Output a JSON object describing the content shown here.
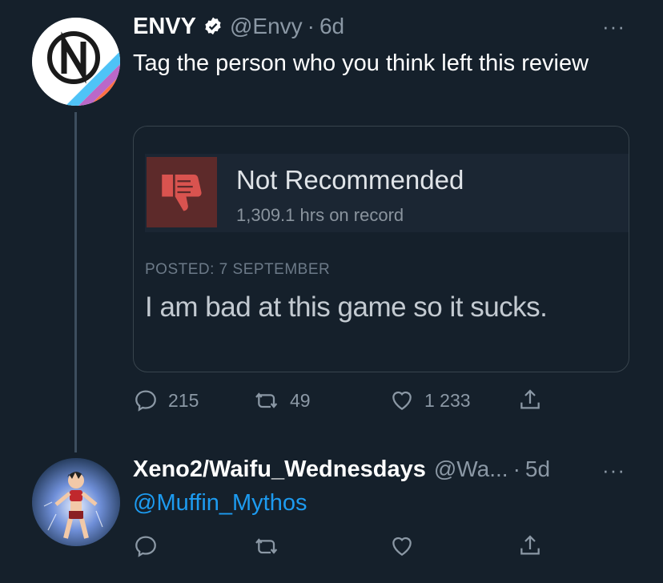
{
  "tweet": {
    "author_name": "ENVY",
    "handle": "@Envy",
    "separator": "·",
    "time": "6d",
    "text": "Tag the person who you think left this review",
    "more": "···",
    "embed": {
      "status": "Not Recommended",
      "hours": "1,309.1 hrs on record",
      "posted": "POSTED: 7 SEPTEMBER",
      "review": "I am bad at this game so it sucks."
    },
    "actions": {
      "replies": "215",
      "retweets": "49",
      "likes": "1 233"
    }
  },
  "reply": {
    "author_name": "Xeno2/Waifu_Wednesdays",
    "handle": "@Wa...",
    "separator": "·",
    "time": "5d",
    "more": "···",
    "text": "@Muffin_Mythos"
  },
  "colors": {
    "background": "#15202b",
    "accent": "#1d9bf0",
    "secondary_text": "#8b98a5",
    "thumb_down": "#d9534f"
  },
  "icons": [
    "verified-badge-icon",
    "more-icon",
    "thumbs-down-icon",
    "reply-icon",
    "retweet-icon",
    "like-icon",
    "share-icon"
  ]
}
